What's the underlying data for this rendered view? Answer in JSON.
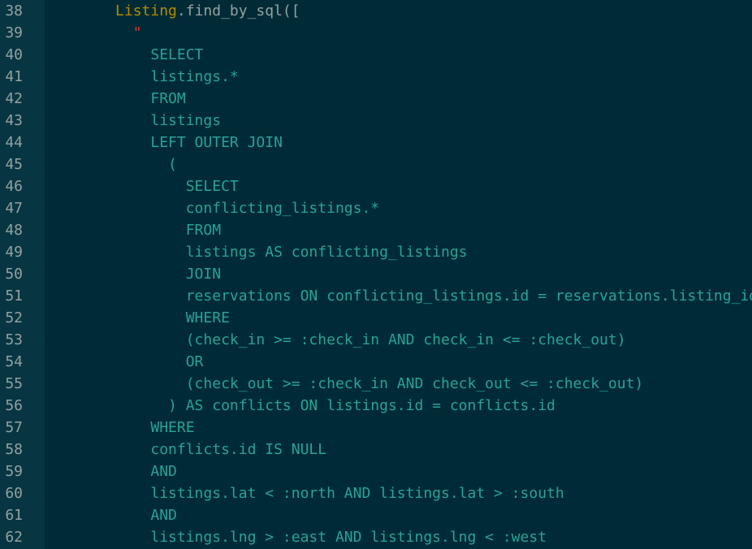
{
  "colors": {
    "background": "#002b36",
    "gutter": "#073642",
    "line_number": "#93a1a1",
    "class_name": "#b58900",
    "method": "#93a1a1",
    "string_quote": "#dc322f",
    "sql_text": "#2aa198"
  },
  "lines": [
    {
      "number": "38",
      "segments": [
        {
          "text": "      "
        },
        {
          "text": "Listing",
          "type": "class"
        },
        {
          "text": ".find_by_sql([",
          "type": "method"
        }
      ]
    },
    {
      "number": "39",
      "segments": [
        {
          "text": "        "
        },
        {
          "text": "\"",
          "type": "string"
        }
      ]
    },
    {
      "number": "40",
      "segments": [
        {
          "text": "          SELECT",
          "type": "sql"
        }
      ]
    },
    {
      "number": "41",
      "segments": [
        {
          "text": "          listings.*",
          "type": "sql"
        }
      ]
    },
    {
      "number": "42",
      "segments": [
        {
          "text": "          FROM",
          "type": "sql"
        }
      ]
    },
    {
      "number": "43",
      "segments": [
        {
          "text": "          listings",
          "type": "sql"
        }
      ]
    },
    {
      "number": "44",
      "segments": [
        {
          "text": "          LEFT OUTER JOIN",
          "type": "sql"
        }
      ]
    },
    {
      "number": "45",
      "segments": [
        {
          "text": "            (",
          "type": "sql"
        }
      ]
    },
    {
      "number": "46",
      "segments": [
        {
          "text": "              SELECT",
          "type": "sql"
        }
      ]
    },
    {
      "number": "47",
      "segments": [
        {
          "text": "              conflicting_listings.*",
          "type": "sql"
        }
      ]
    },
    {
      "number": "48",
      "segments": [
        {
          "text": "              FROM",
          "type": "sql"
        }
      ]
    },
    {
      "number": "49",
      "segments": [
        {
          "text": "              listings AS conflicting_listings",
          "type": "sql"
        }
      ]
    },
    {
      "number": "50",
      "segments": [
        {
          "text": "              JOIN",
          "type": "sql"
        }
      ]
    },
    {
      "number": "51",
      "segments": [
        {
          "text": "              reservations ON conflicting_listings.id = reservations.listing_id",
          "type": "sql"
        }
      ]
    },
    {
      "number": "52",
      "segments": [
        {
          "text": "              WHERE",
          "type": "sql"
        }
      ]
    },
    {
      "number": "53",
      "segments": [
        {
          "text": "              (check_in >= :check_in AND check_in <= :check_out)",
          "type": "sql"
        }
      ]
    },
    {
      "number": "54",
      "segments": [
        {
          "text": "              OR",
          "type": "sql"
        }
      ]
    },
    {
      "number": "55",
      "segments": [
        {
          "text": "              (check_out >= :check_in AND check_out <= :check_out)",
          "type": "sql"
        }
      ]
    },
    {
      "number": "56",
      "segments": [
        {
          "text": "            ) AS conflicts ON listings.id = conflicts.id",
          "type": "sql"
        }
      ]
    },
    {
      "number": "57",
      "segments": [
        {
          "text": "          WHERE",
          "type": "sql"
        }
      ]
    },
    {
      "number": "58",
      "segments": [
        {
          "text": "          conflicts.id IS NULL",
          "type": "sql"
        }
      ]
    },
    {
      "number": "59",
      "segments": [
        {
          "text": "          AND",
          "type": "sql"
        }
      ]
    },
    {
      "number": "60",
      "segments": [
        {
          "text": "          listings.lat < :north AND listings.lat > :south",
          "type": "sql"
        }
      ]
    },
    {
      "number": "61",
      "segments": [
        {
          "text": "          AND",
          "type": "sql"
        }
      ]
    },
    {
      "number": "62",
      "segments": [
        {
          "text": "          listings.lng > :east AND listings.lng < :west",
          "type": "sql"
        }
      ]
    }
  ]
}
